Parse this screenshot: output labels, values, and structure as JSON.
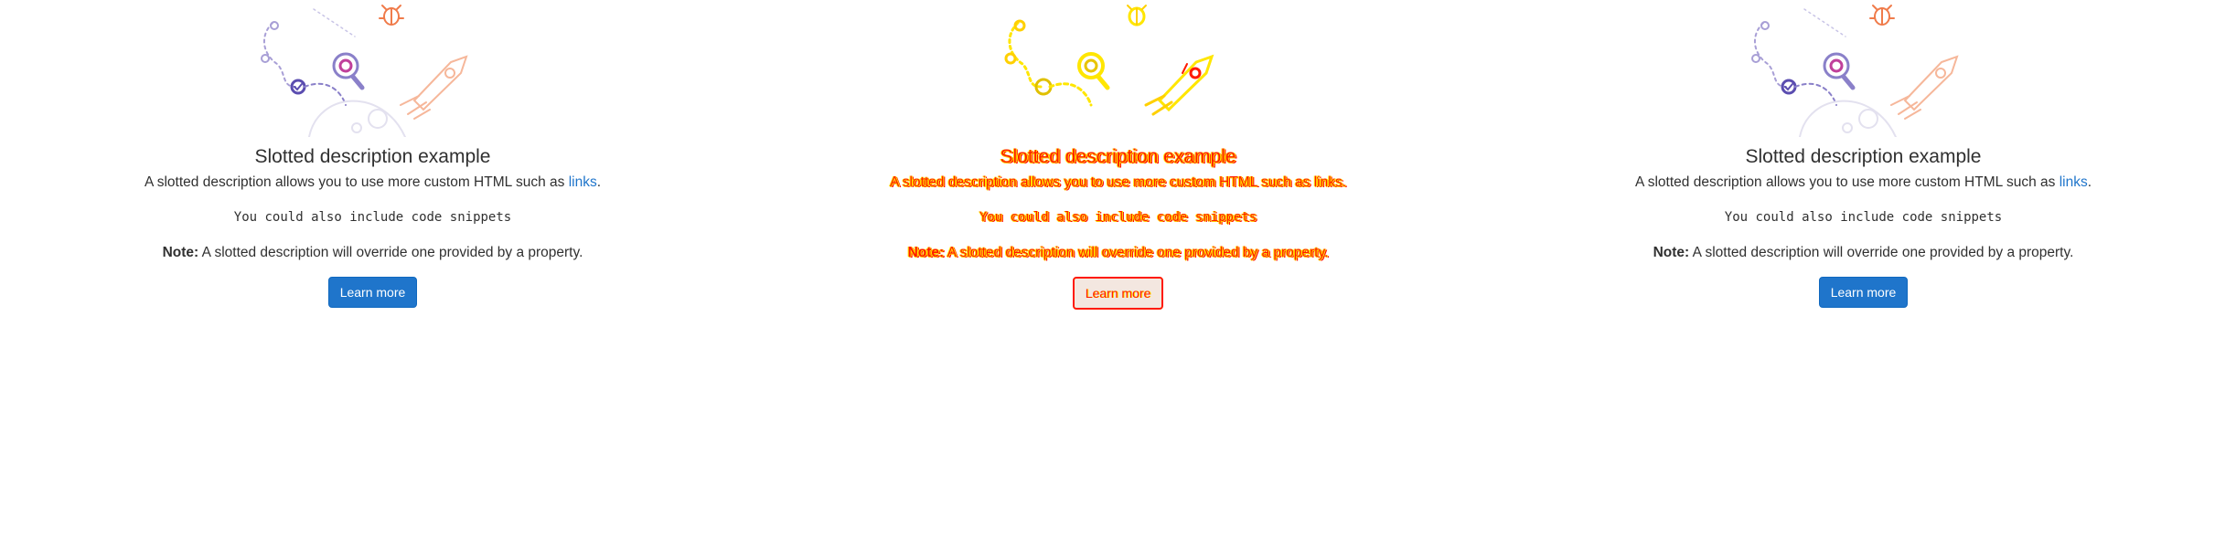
{
  "panels": [
    {
      "id": "expected",
      "title": "Slotted description example",
      "description_prefix": "A slotted description allows you to use more custom HTML such as ",
      "description_link": "links",
      "description_suffix": ".",
      "code_snippet": "You could also include code snippets",
      "note_label": "Note:",
      "note_text": " A slotted description will override one provided by a property.",
      "button_label": "Learn more"
    },
    {
      "id": "diff",
      "title": "Slotted description example",
      "description_prefix": "A slotted description allows you to use more custom HTML such as ",
      "description_link": "links",
      "description_suffix": ".",
      "code_snippet": "You could also include code snippets",
      "note_label": "Note:",
      "note_text": " A slotted description will override one provided by a property.",
      "button_label": "Learn more"
    },
    {
      "id": "actual",
      "title": "Slotted description example",
      "description_prefix": "A slotted description allows you to use more custom HTML such as ",
      "description_link": "links",
      "description_suffix": ".",
      "code_snippet": "You could also include code snippets",
      "note_label": "Note:",
      "note_text": " A slotted description will override one provided by a property.",
      "button_label": "Learn more"
    }
  ],
  "colors": {
    "primary": "#1f75cb",
    "text": "#303030",
    "diff_red": "#ff1a00",
    "diff_yellow": "#ffe600"
  },
  "icons": [
    "empty-state-illustration"
  ]
}
